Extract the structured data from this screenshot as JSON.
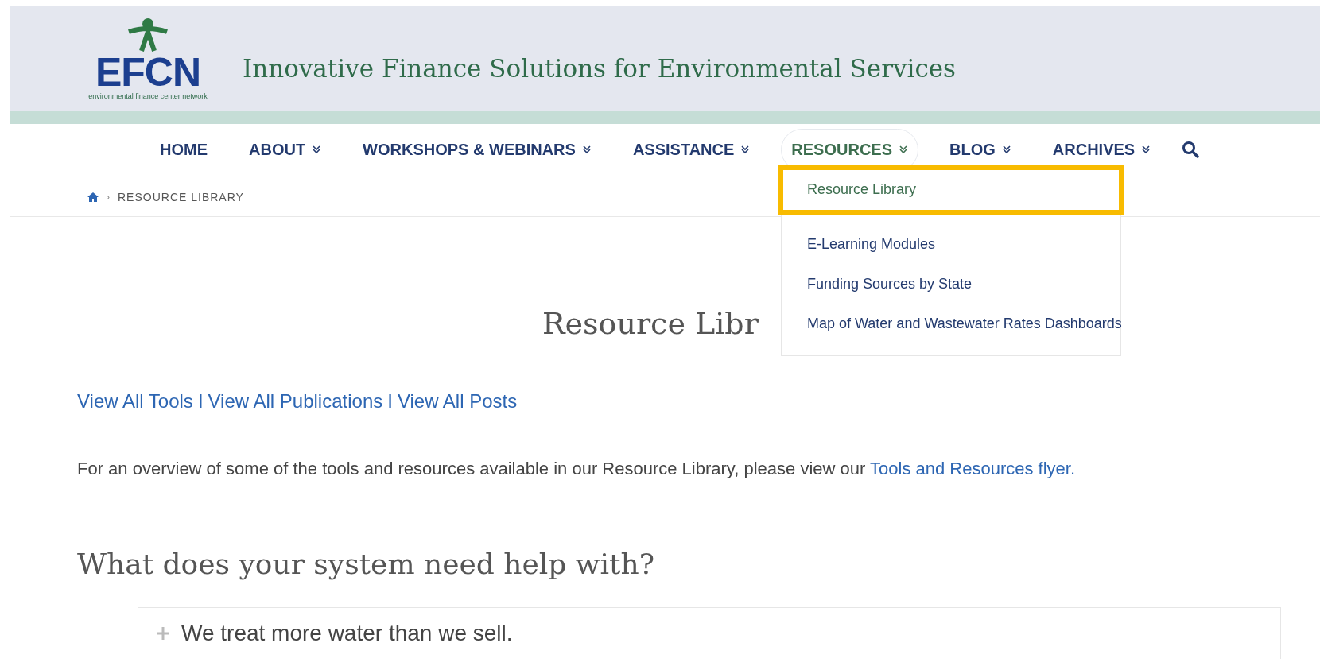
{
  "header": {
    "logo": {
      "wordmark": "EFCN",
      "subtitle": "environmental finance center network"
    },
    "tagline": "Innovative Finance Solutions for Environmental Services"
  },
  "nav": {
    "items": [
      {
        "label": "HOME",
        "has_menu": false,
        "selected": false
      },
      {
        "label": "ABOUT",
        "has_menu": true,
        "selected": false
      },
      {
        "label": "WORKSHOPS & WEBINARS",
        "has_menu": true,
        "selected": false
      },
      {
        "label": "ASSISTANCE",
        "has_menu": true,
        "selected": false
      },
      {
        "label": "RESOURCES",
        "has_menu": true,
        "selected": true
      },
      {
        "label": "BLOG",
        "has_menu": true,
        "selected": false
      },
      {
        "label": "ARCHIVES",
        "has_menu": true,
        "selected": false
      }
    ]
  },
  "dropdown": {
    "items": [
      {
        "label": "Resource Library",
        "highlighted": true
      },
      {
        "label": "E-Learning Modules",
        "highlighted": false
      },
      {
        "label": "Funding Sources by State",
        "highlighted": false
      },
      {
        "label": "Map of Water and Wastewater Rates Dashboards",
        "highlighted": false
      }
    ]
  },
  "breadcrumb": {
    "separator": "›",
    "current": "RESOURCE LIBRARY"
  },
  "page_title": "Resource Libr",
  "quick_links": {
    "links": [
      "View All Tools",
      "View All Publications",
      "View All Posts"
    ],
    "separators": [
      "I",
      "I"
    ]
  },
  "intro": {
    "text": "For an overview of some of the tools and resources available in our Resource Library, please view our",
    "link": "Tools and Resources flyer."
  },
  "help_heading": "What does your system need help with?",
  "accordion": [
    {
      "label": "We treat more water than we sell.",
      "expanded": false
    }
  ]
}
